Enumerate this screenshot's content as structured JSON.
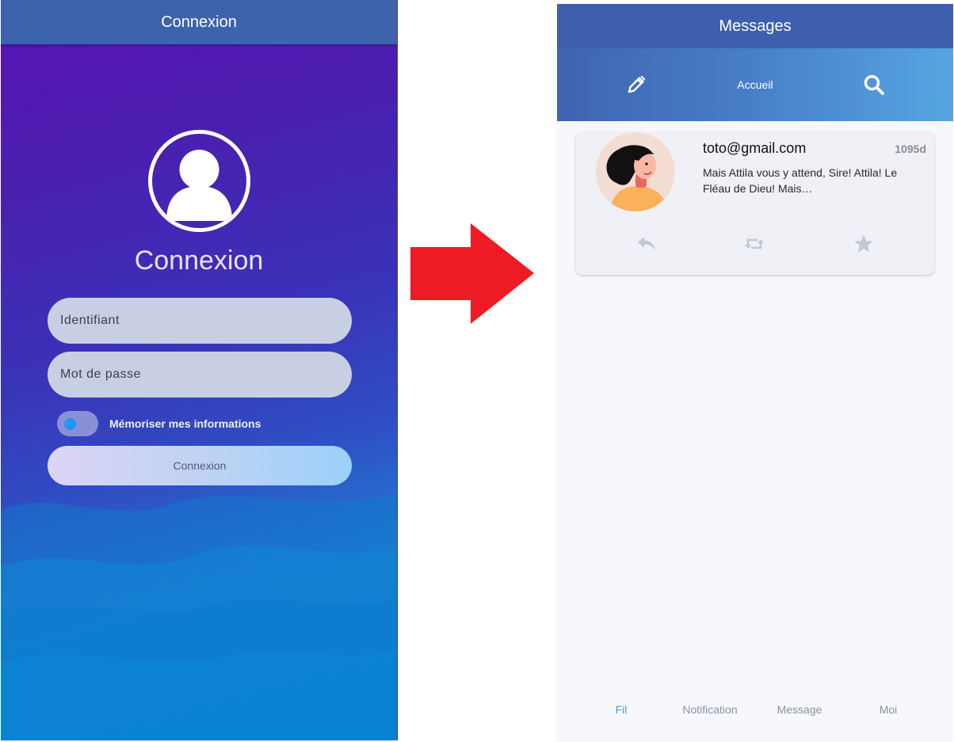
{
  "login": {
    "appbar_title": "Connexion",
    "heading": "Connexion",
    "username_placeholder": "Identifiant",
    "password_placeholder": "Mot de passe",
    "remember_label": "Mémoriser mes informations",
    "remember_enabled": true,
    "submit_label": "Connexion",
    "avatar_icon": "user-avatar-icon"
  },
  "arrow": {
    "icon": "right-arrow-icon",
    "color": "#ed1c24"
  },
  "messages": {
    "appbar_title": "Messages",
    "toolbar": {
      "left_icon": "pencil-icon",
      "center_label": "Accueil",
      "right_icon": "search-icon"
    },
    "items": [
      {
        "email": "toto@gmail.com",
        "time": "1095d",
        "body": "Mais Attila vous y attend, Sire! Attila! Le Fléau de Dieu! Mais…",
        "actions": [
          "reply-icon",
          "retweet-icon",
          "star-icon"
        ]
      }
    ],
    "bottom_nav": [
      {
        "label": "Fil",
        "active": true
      },
      {
        "label": "Notification",
        "active": false
      },
      {
        "label": "Message",
        "active": false
      },
      {
        "label": "Moi",
        "active": false
      }
    ]
  },
  "colors": {
    "accent": "#3e5fad",
    "nav_active": "#4a9ad9"
  }
}
